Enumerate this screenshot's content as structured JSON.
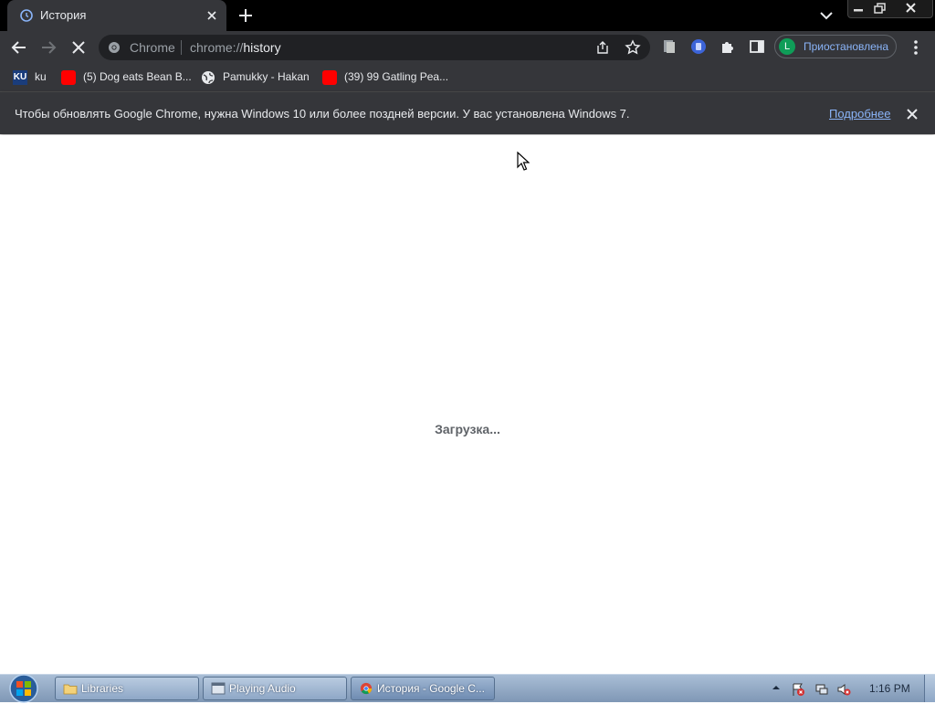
{
  "tab": {
    "title": "История",
    "favicon": "history-icon"
  },
  "toolbar": {
    "omnibox_chip": "Chrome",
    "url_scheme": "chrome://",
    "url_path": "history",
    "profile_initial": "L",
    "profile_status": "Приостановлена"
  },
  "bookmarks": [
    {
      "label": "ku",
      "icon": "ku-favicon"
    },
    {
      "label": "(5) Dog eats Bean B...",
      "icon": "youtube-icon"
    },
    {
      "label": "Pamukky - Hakan",
      "icon": "globe-icon"
    },
    {
      "label": "(39) 99 Gatling Pea...",
      "icon": "youtube-icon"
    }
  ],
  "infobar": {
    "message": "Чтобы обновлять Google Chrome, нужна Windows 10 или более поздней версии. У вас установлена Windows 7.",
    "link": "Подробнее"
  },
  "content": {
    "loading": "Загрузка..."
  },
  "taskbar": {
    "tasks": [
      {
        "label": "Libraries",
        "icon": "folder-icon"
      },
      {
        "label": "Playing Audio",
        "icon": "window-icon"
      },
      {
        "label": "История - Google C...",
        "icon": "chrome-icon"
      }
    ],
    "clock": "1:16 PM"
  },
  "colors": {
    "tab_bg": "#35363a",
    "strip_bg": "#000000",
    "link": "#8ab4f8",
    "profile_avatar": "#0f9d58"
  }
}
